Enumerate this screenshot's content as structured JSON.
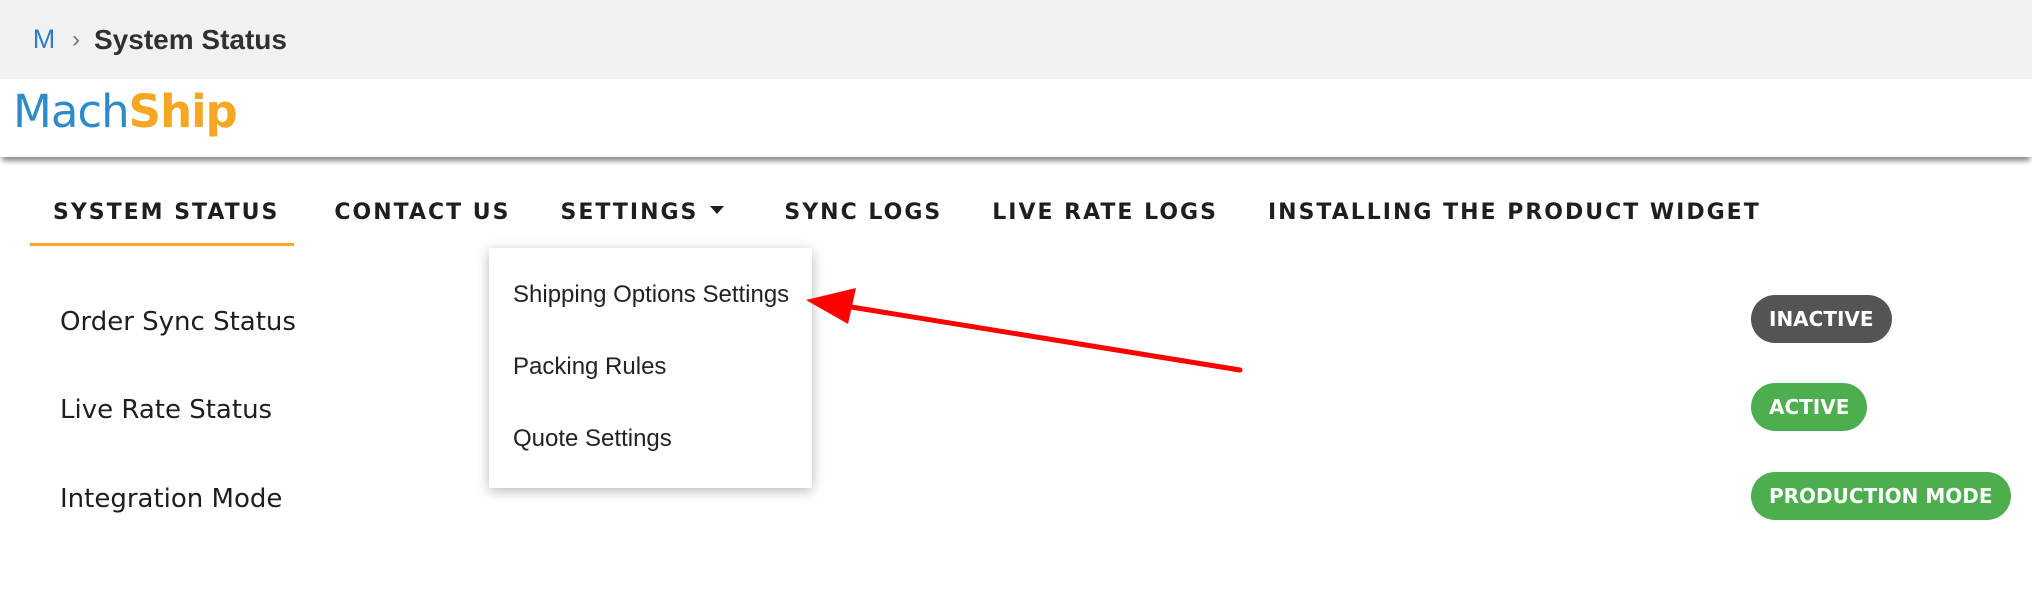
{
  "breadcrumb": {
    "app_initial": "M",
    "separator": "›",
    "title": "System Status"
  },
  "logo": {
    "part1": "Mach",
    "part2": "Ship"
  },
  "tabs": [
    {
      "label": "SYSTEM STATUS",
      "active": true
    },
    {
      "label": "CONTACT US",
      "active": false
    },
    {
      "label": "SETTINGS",
      "active": false,
      "has_dropdown": true
    },
    {
      "label": "SYNC LOGS",
      "active": false
    },
    {
      "label": "LIVE RATE LOGS",
      "active": false
    },
    {
      "label": "INSTALLING THE PRODUCT WIDGET",
      "active": false
    }
  ],
  "settings_menu": {
    "items": [
      {
        "label": "Shipping Options Settings"
      },
      {
        "label": "Packing Rules"
      },
      {
        "label": "Quote Settings"
      }
    ]
  },
  "status_rows": [
    {
      "label": "Order Sync Status",
      "badge": "INACTIVE",
      "badge_color": "#545454"
    },
    {
      "label": "Live Rate Status",
      "badge": "ACTIVE",
      "badge_color": "#4cae4f"
    },
    {
      "label": "Integration Mode",
      "badge": "PRODUCTION MODE",
      "badge_color": "#4cae4f"
    }
  ],
  "colors": {
    "accent": "#f5a623",
    "brand_blue": "#2e8bc9",
    "annotation_arrow": "#ff0000"
  }
}
